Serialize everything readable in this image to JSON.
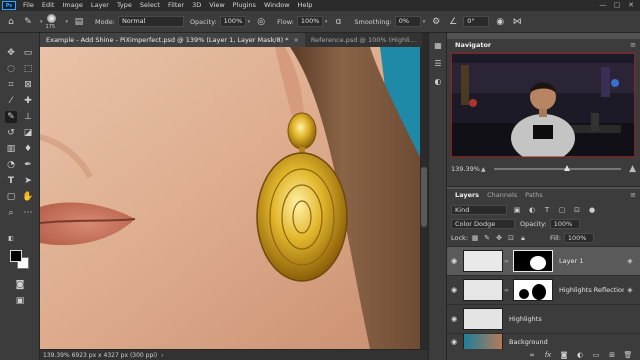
{
  "app": {
    "logo": "Ps"
  },
  "menu": [
    "File",
    "Edit",
    "Image",
    "Layer",
    "Type",
    "Select",
    "Filter",
    "3D",
    "View",
    "Plugins",
    "Window",
    "Help"
  ],
  "window_controls": [
    "—",
    "▢",
    "✕"
  ],
  "options": {
    "brush_size": "175",
    "mode_label": "Mode:",
    "mode_value": "Normal",
    "opacity_label": "Opacity:",
    "opacity_value": "100%",
    "flow_label": "Flow:",
    "flow_value": "100%",
    "smoothing_label": "Smoothing:",
    "smoothing_value": "0%",
    "angle_value": "0°"
  },
  "tabs": [
    {
      "label": "Example - Add Shine - PiXimperfect.psd @ 139% (Layer 1, Layer Mask/8) *",
      "active": true
    },
    {
      "label": "Reference.psd @ 100% (Highli...",
      "active": false
    }
  ],
  "status": {
    "text": "139.39%  6923 px x 4327 px (300 ppi)",
    "arrow": "›"
  },
  "navigator": {
    "title": "Navigator",
    "zoom": "139.39%"
  },
  "layers": {
    "tabs": [
      "Layers",
      "Channels",
      "Paths"
    ],
    "kind_label": "Kind",
    "blend_mode": "Color Dodge",
    "opacity_label": "Opacity:",
    "opacity_value": "100%",
    "lock_label": "Lock:",
    "fill_label": "Fill:",
    "fill_value": "100%",
    "items": [
      {
        "name": "Layer 1",
        "selected": true
      },
      {
        "name": "Highlights Reflection",
        "selected": false
      },
      {
        "name": "Highlights",
        "selected": false
      },
      {
        "name": "Background",
        "selected": false
      }
    ]
  },
  "colors": {
    "accent": "#31a8ff",
    "panel": "#3c3c3c",
    "menubar": "#2b2b2b"
  }
}
